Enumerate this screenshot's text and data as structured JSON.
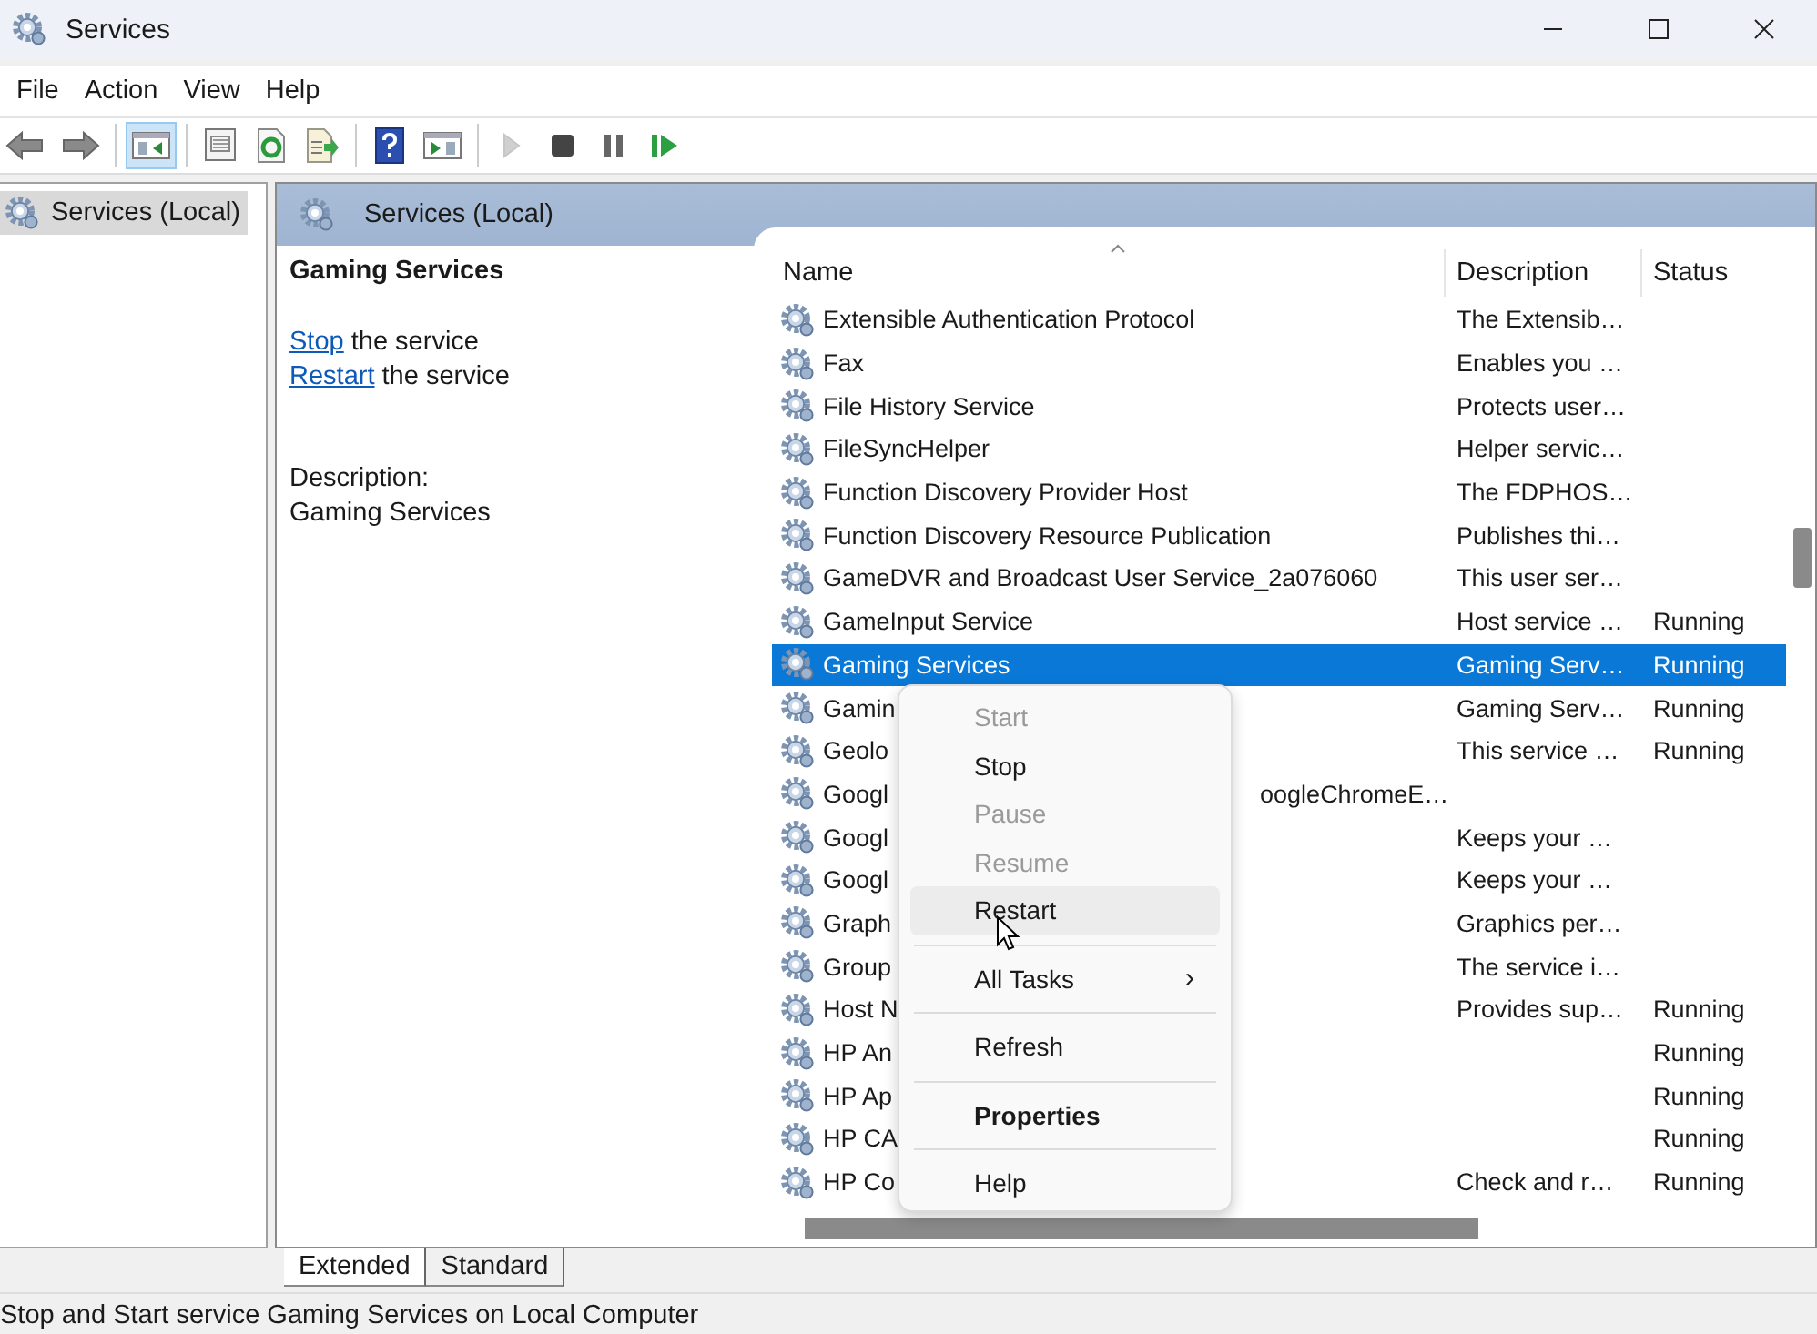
{
  "window": {
    "title": "Services"
  },
  "menu_bar": [
    "File",
    "Action",
    "View",
    "Help"
  ],
  "toolbar": [
    {
      "kind": "back",
      "pressed": false,
      "disabled": false
    },
    {
      "kind": "forward",
      "pressed": false,
      "disabled": false
    },
    {
      "kind": "separator"
    },
    {
      "kind": "console-tree",
      "pressed": true,
      "disabled": false
    },
    {
      "kind": "separator"
    },
    {
      "kind": "properties",
      "pressed": false,
      "disabled": false
    },
    {
      "kind": "refresh",
      "pressed": false,
      "disabled": false
    },
    {
      "kind": "export",
      "pressed": false,
      "disabled": false
    },
    {
      "kind": "separator"
    },
    {
      "kind": "help",
      "pressed": false,
      "disabled": false
    },
    {
      "kind": "action-pane",
      "pressed": false,
      "disabled": false
    },
    {
      "kind": "separator"
    },
    {
      "kind": "play",
      "pressed": false,
      "disabled": true
    },
    {
      "kind": "stop",
      "pressed": false,
      "disabled": false
    },
    {
      "kind": "pause",
      "pressed": false,
      "disabled": false
    },
    {
      "kind": "resume",
      "pressed": false,
      "disabled": false
    }
  ],
  "tree": {
    "items": [
      {
        "label": "Services (Local)",
        "selected": true
      }
    ]
  },
  "panel": {
    "title": "Services (Local)",
    "detail": {
      "title": "Gaming Services",
      "actions": [
        {
          "link": "Stop",
          "text": "the service"
        },
        {
          "link": "Restart",
          "text": "the service"
        }
      ],
      "description_label": "Description:",
      "description": "Gaming Services"
    },
    "table": {
      "columns": [
        "Name",
        "Description",
        "Status"
      ],
      "rows": [
        {
          "name": "Extensible Authentication Protocol",
          "description": "The Extensib…",
          "status": "",
          "selected": false
        },
        {
          "name": "Fax",
          "description": "Enables you …",
          "status": "",
          "selected": false
        },
        {
          "name": "File History Service",
          "description": "Protects user…",
          "status": "",
          "selected": false
        },
        {
          "name": "FileSyncHelper",
          "description": "Helper servic…",
          "status": "",
          "selected": false
        },
        {
          "name": "Function Discovery Provider Host",
          "description": "The FDPHOS…",
          "status": "",
          "selected": false
        },
        {
          "name": "Function Discovery Resource Publication",
          "description": "Publishes thi…",
          "status": "",
          "selected": false
        },
        {
          "name": "GameDVR and Broadcast User Service_2a076060",
          "description": "This user ser…",
          "status": "",
          "selected": false
        },
        {
          "name": "GameInput Service",
          "description": "Host service …",
          "status": "Running",
          "selected": false
        },
        {
          "name": "Gaming Services",
          "description": "Gaming Serv…",
          "status": "Running",
          "selected": true
        },
        {
          "name": "Gamin",
          "description": "Gaming Serv…",
          "status": "Running",
          "selected": false
        },
        {
          "name": "Geolo",
          "description": "This service …",
          "status": "Running",
          "selected": false
        },
        {
          "name": "Googl",
          "name_tail": "oogleChromeE…",
          "description": "",
          "status": "",
          "selected": false
        },
        {
          "name": "Googl",
          "description": "Keeps your …",
          "status": "",
          "selected": false
        },
        {
          "name": "Googl",
          "description": "Keeps your …",
          "status": "",
          "selected": false
        },
        {
          "name": "Graph",
          "description": "Graphics per…",
          "status": "",
          "selected": false
        },
        {
          "name": "Group",
          "description": "The service i…",
          "status": "",
          "selected": false
        },
        {
          "name": "Host N",
          "description": "Provides sup…",
          "status": "Running",
          "selected": false
        },
        {
          "name": "HP An",
          "description": "",
          "status": "Running",
          "selected": false
        },
        {
          "name": "HP Ap",
          "description": "",
          "status": "Running",
          "selected": false
        },
        {
          "name": "HP CA",
          "description": "",
          "status": "Running",
          "selected": false
        },
        {
          "name": "HP Co",
          "description": "Check and r…",
          "status": "Running",
          "selected": false
        }
      ]
    }
  },
  "context_menu": [
    {
      "kind": "item",
      "label": "Start",
      "disabled": true,
      "hovered": false,
      "bold": false
    },
    {
      "kind": "item",
      "label": "Stop",
      "disabled": false,
      "hovered": false,
      "bold": false
    },
    {
      "kind": "item",
      "label": "Pause",
      "disabled": true,
      "hovered": false,
      "bold": false
    },
    {
      "kind": "item",
      "label": "Resume",
      "disabled": true,
      "hovered": false,
      "bold": false
    },
    {
      "kind": "item",
      "label": "Restart",
      "disabled": false,
      "hovered": true,
      "bold": false
    },
    {
      "kind": "separator"
    },
    {
      "kind": "item",
      "label": "All Tasks",
      "submenu_arrow": "›",
      "disabled": false,
      "hovered": false,
      "bold": false
    },
    {
      "kind": "separator"
    },
    {
      "kind": "item",
      "label": "Refresh",
      "disabled": false,
      "hovered": false,
      "bold": false
    },
    {
      "kind": "separator"
    },
    {
      "kind": "item",
      "label": "Properties",
      "disabled": false,
      "hovered": false,
      "bold": true
    },
    {
      "kind": "separator"
    },
    {
      "kind": "item",
      "label": "Help",
      "disabled": false,
      "hovered": false,
      "bold": false
    }
  ],
  "view_tabs": [
    {
      "label": "Extended",
      "selected": true
    },
    {
      "label": "Standard",
      "selected": false
    }
  ],
  "status_bar": "Stop and Start service Gaming Services on Local Computer"
}
